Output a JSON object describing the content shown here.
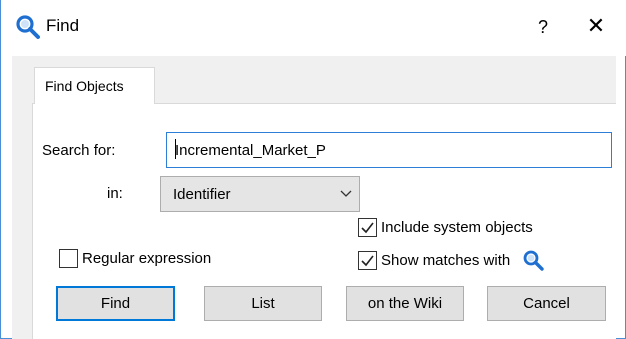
{
  "window": {
    "title": "Find",
    "help_label": "?",
    "close_label": "✕"
  },
  "tabs": [
    {
      "label": "Find Objects",
      "active": true
    }
  ],
  "form": {
    "search_label": "Search for:",
    "search_value": "Incremental_Market_P",
    "in_label": "in:",
    "in_selected": "Identifier"
  },
  "options": {
    "include_system": {
      "label": "Include system objects",
      "checked": true
    },
    "regex": {
      "label": "Regular expression",
      "checked": false
    },
    "show_matches": {
      "label": "Show matches with",
      "checked": true
    }
  },
  "buttons": {
    "find": "Find",
    "list": "List",
    "wiki": "on the Wiki",
    "cancel": "Cancel"
  },
  "icons": {
    "title_icon": "magnifier-icon",
    "show_matches_icon": "magnifier-icon"
  },
  "colors": {
    "accent": "#2c7ed6",
    "magnifier": "#1f6fd1"
  }
}
